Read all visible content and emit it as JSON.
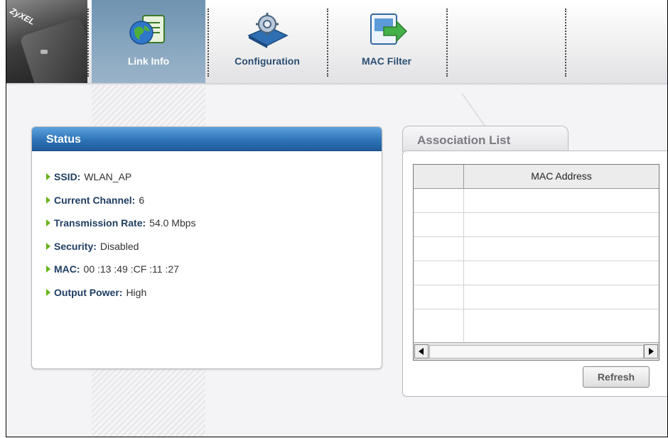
{
  "brand": {
    "logo_text": "ZyXEL"
  },
  "nav": {
    "tabs": [
      {
        "label": "Link Info",
        "icon": "globe-document-icon",
        "active": true
      },
      {
        "label": "Configuration",
        "icon": "gear-device-icon",
        "active": false
      },
      {
        "label": "MAC Filter",
        "icon": "arrow-screen-icon",
        "active": false
      }
    ]
  },
  "status": {
    "title": "Status",
    "items": [
      {
        "label": "SSID:",
        "value": "WLAN_AP"
      },
      {
        "label": "Current Channel:",
        "value": "6"
      },
      {
        "label": "Transmission Rate:",
        "value": "54.0 Mbps"
      },
      {
        "label": "Security:",
        "value": "Disabled"
      },
      {
        "label": "MAC:",
        "value": "00 :13 :49 :CF :11 :27"
      },
      {
        "label": "Output Power:",
        "value": "High"
      }
    ]
  },
  "association": {
    "title": "Association List",
    "columns": [
      "",
      "MAC Address"
    ],
    "rows": [
      [
        "",
        ""
      ],
      [
        "",
        ""
      ],
      [
        "",
        ""
      ],
      [
        "",
        ""
      ],
      [
        "",
        ""
      ],
      [
        "",
        ""
      ]
    ],
    "refresh_label": "Refresh"
  },
  "colors": {
    "accent": "#2e73b7",
    "active_tab": "#8eabc3",
    "bullet": "#67b51b"
  }
}
